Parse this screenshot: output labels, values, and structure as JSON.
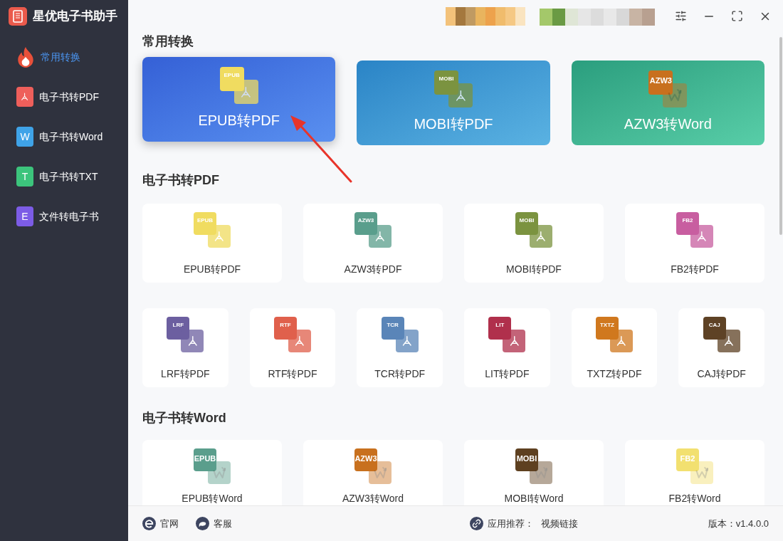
{
  "app": {
    "title": "星优电子书助手"
  },
  "sidebar": {
    "items": [
      {
        "label": "常用转换",
        "selected": true,
        "kind": "fire",
        "color": "#e8503a"
      },
      {
        "label": "电子书转PDF",
        "selected": false,
        "kind": "pdf",
        "color": "#ee5f5b"
      },
      {
        "label": "电子书转Word",
        "selected": false,
        "kind": "letter",
        "letter": "W",
        "color": "#3fa3e8"
      },
      {
        "label": "电子书转TXT",
        "selected": false,
        "kind": "letter",
        "letter": "T",
        "color": "#3cc47c"
      },
      {
        "label": "文件转电子书",
        "selected": false,
        "kind": "letter",
        "letter": "E",
        "color": "#7c5ce6"
      }
    ]
  },
  "sections": [
    {
      "title": "常用转换",
      "kind": "featured",
      "items": [
        {
          "label": "EPUB转PDF",
          "format": "EPUB",
          "kind": "pdf",
          "color": "#f0dc60",
          "hovered": true
        },
        {
          "label": "MOBI转PDF",
          "format": "MOBI",
          "kind": "pdf",
          "color": "#7b9340",
          "hovered": false
        },
        {
          "label": "AZW3转Word",
          "format": "AZW3",
          "kind": "word",
          "color": "#c8701e",
          "hovered": false
        }
      ]
    },
    {
      "title": "电子书转PDF",
      "kind": "grid",
      "rows": [
        [
          {
            "label": "EPUB转PDF",
            "format": "EPUB",
            "kind": "pdf",
            "color": "#f0dc60"
          },
          {
            "label": "AZW3转PDF",
            "format": "AZW3",
            "kind": "pdf",
            "color": "#5a9e8c"
          },
          {
            "label": "MOBI转PDF",
            "format": "MOBI",
            "kind": "pdf",
            "color": "#7b9340"
          },
          {
            "label": "FB2转PDF",
            "format": "FB2",
            "kind": "pdf",
            "color": "#c85ea0"
          }
        ],
        [
          {
            "label": "LRF转PDF",
            "format": "LRF",
            "kind": "pdf",
            "color": "#6c5fa0"
          },
          {
            "label": "RTF转PDF",
            "format": "RTF",
            "kind": "pdf",
            "color": "#e0604c"
          },
          {
            "label": "TCR转PDF",
            "format": "TCR",
            "kind": "pdf",
            "color": "#5a85b8"
          },
          {
            "label": "LIT转PDF",
            "format": "LIT",
            "kind": "pdf",
            "color": "#b0304c"
          },
          {
            "label": "TXTZ转PDF",
            "format": "TXTZ",
            "kind": "pdf",
            "color": "#d0781e"
          },
          {
            "label": "CAJ转PDF",
            "format": "CAJ",
            "kind": "pdf",
            "color": "#5e4225"
          }
        ]
      ]
    },
    {
      "title": "电子书转Word",
      "kind": "grid",
      "rows": [
        [
          {
            "label": "EPUB转Word",
            "format": "EPUB",
            "kind": "word",
            "color": "#5a9e8c"
          },
          {
            "label": "AZW3转Word",
            "format": "AZW3",
            "kind": "word",
            "color": "#c8701e"
          },
          {
            "label": "MOBI转Word",
            "format": "MOBI",
            "kind": "word",
            "color": "#5e4020"
          },
          {
            "label": "FB2转Word",
            "format": "FB2",
            "kind": "word",
            "color": "#f2e070"
          }
        ]
      ]
    }
  ],
  "footer": {
    "links": [
      {
        "label": "官网",
        "kind": "browser"
      },
      {
        "label": "客服",
        "kind": "chat"
      }
    ],
    "recommend_label": "应用推荐：",
    "recommend_link": "视频链接",
    "version": "版本：v1.4.0.0"
  }
}
